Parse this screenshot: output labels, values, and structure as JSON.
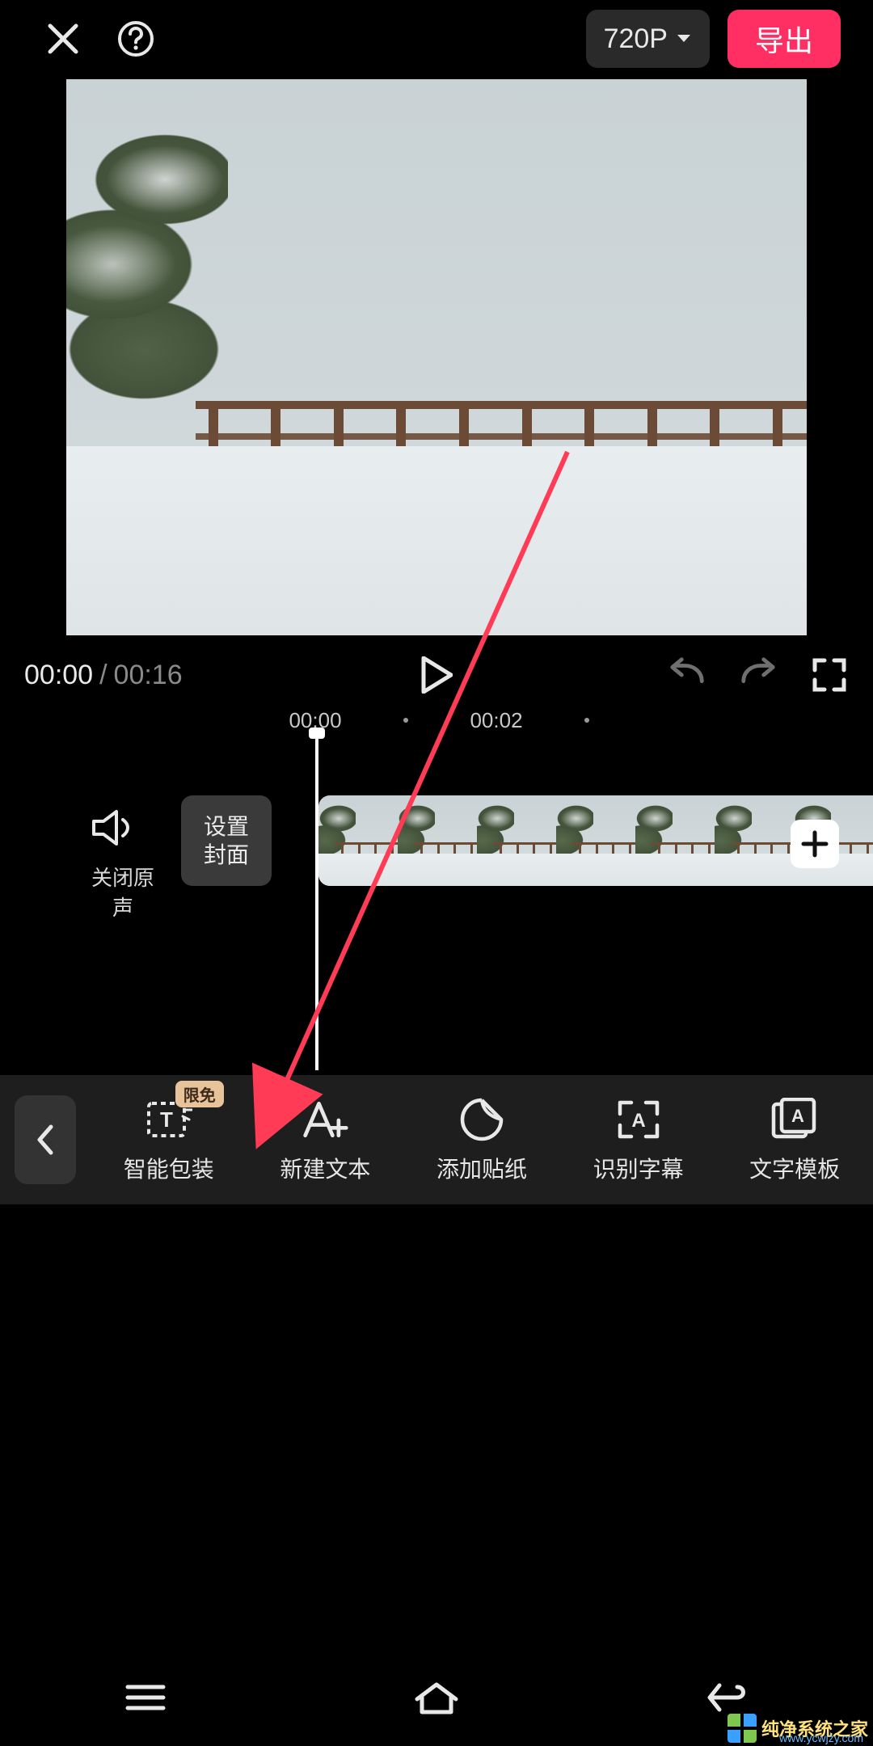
{
  "topbar": {
    "resolution_label": "720P",
    "export_label": "导出"
  },
  "transport": {
    "current_time": "00:00",
    "duration": "00:16"
  },
  "ruler": {
    "ticks": [
      "00:00",
      "00:02"
    ]
  },
  "mute": {
    "label": "关闭原声"
  },
  "cover": {
    "label": "设置\n封面"
  },
  "toolbar": {
    "items": [
      {
        "label": "智能包装",
        "icon": "text-smart-icon",
        "badge": "限免"
      },
      {
        "label": "新建文本",
        "icon": "text-add-icon"
      },
      {
        "label": "添加贴纸",
        "icon": "sticker-icon"
      },
      {
        "label": "识别字幕",
        "icon": "subtitle-icon"
      },
      {
        "label": "文字模板",
        "icon": "text-template-icon"
      }
    ]
  },
  "watermark": {
    "line1": "纯净系统之家",
    "line2": "www.ycwjzy.com"
  },
  "colors": {
    "accent": "#ff2e63",
    "badge": "#e8c29b",
    "arrow": "#ff3b56"
  }
}
